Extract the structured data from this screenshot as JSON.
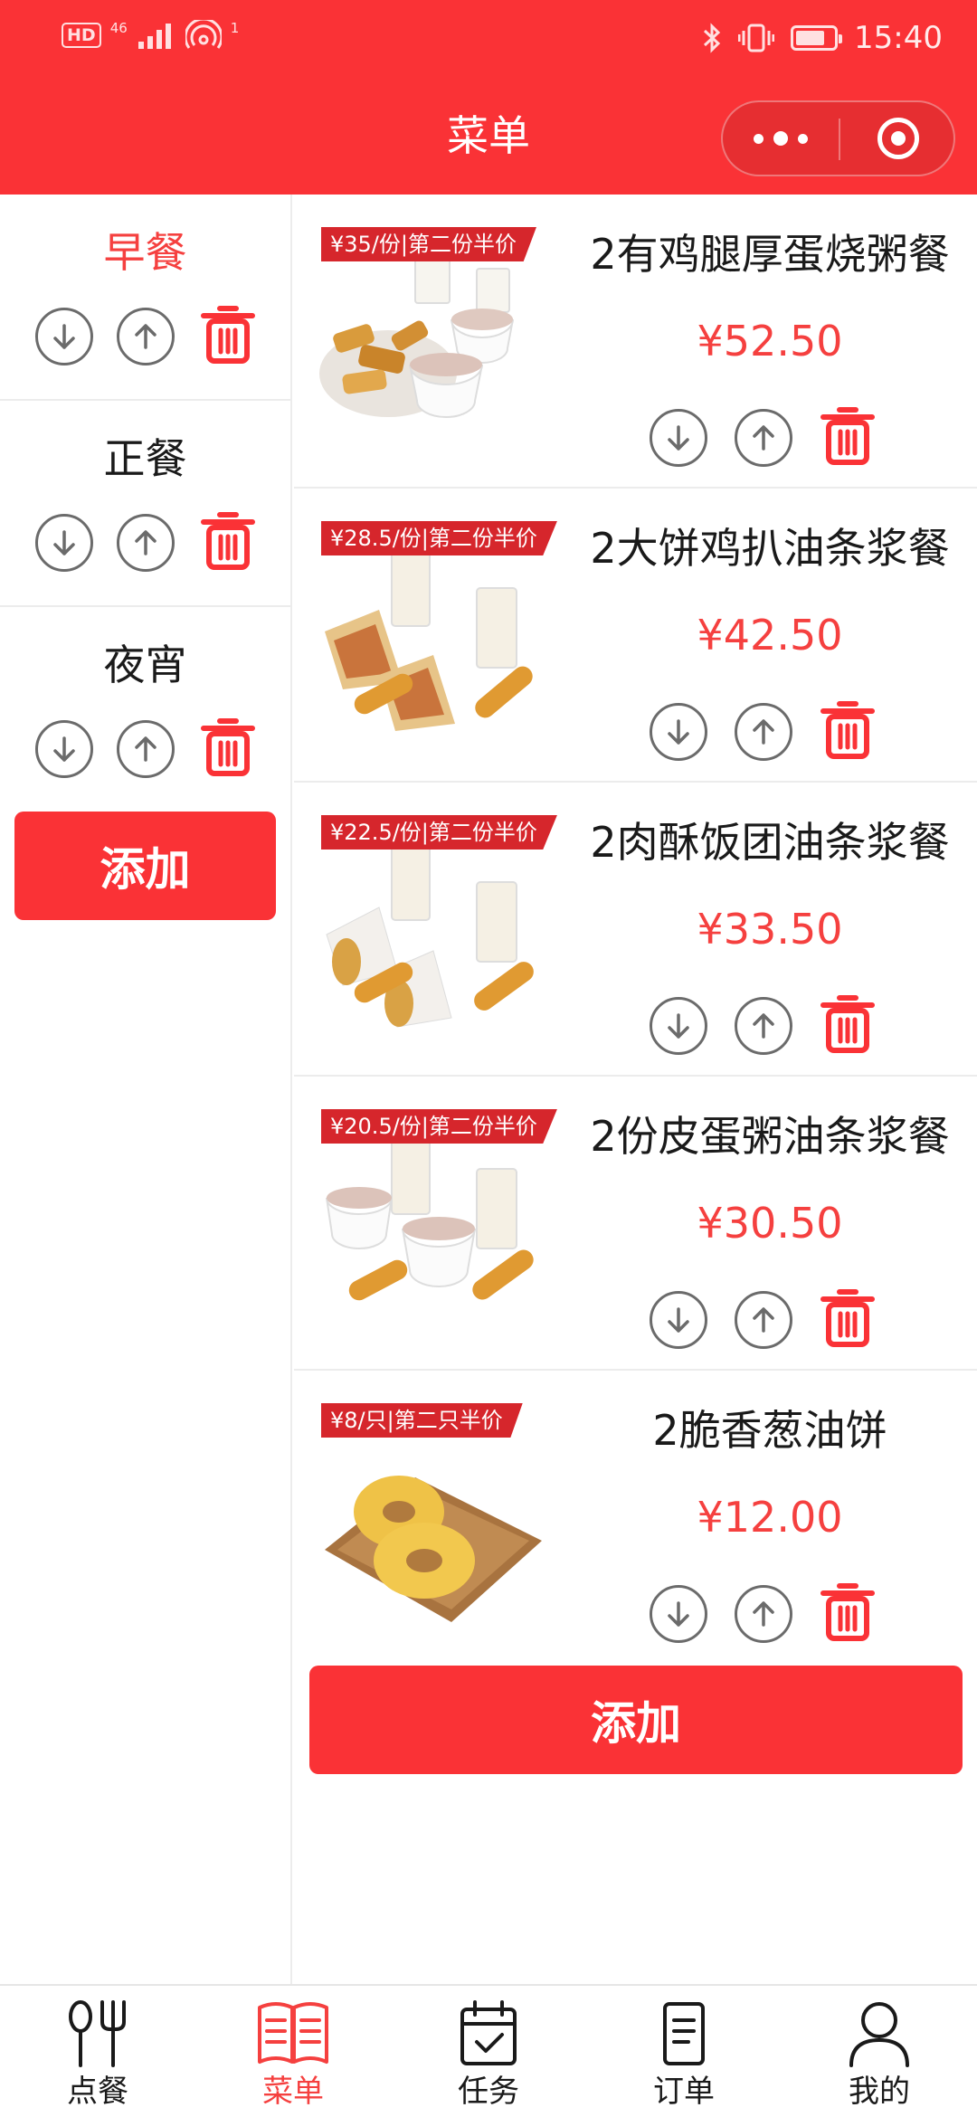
{
  "status_bar": {
    "hd": "HD",
    "net": "46",
    "signal_sup": "1",
    "time": "15:40",
    "battery_level": 0.78
  },
  "header": {
    "title": "菜单"
  },
  "colors": {
    "accent": "#fa3236",
    "price": "#f5403f"
  },
  "sidebar": {
    "categories": [
      {
        "name": "早餐",
        "active": true
      },
      {
        "name": "正餐",
        "active": false
      },
      {
        "name": "夜宵",
        "active": false
      }
    ],
    "add_label": "添加"
  },
  "menu": {
    "items": [
      {
        "promo": "¥35/份|第二份半价",
        "name": "2有鸡腿厚蛋烧粥餐",
        "price": "¥52.50"
      },
      {
        "promo": "¥28.5/份|第二份半价",
        "name": "2大饼鸡扒油条浆餐",
        "price": "¥42.50"
      },
      {
        "promo": "¥22.5/份|第二份半价",
        "name": "2肉酥饭团油条浆餐",
        "price": "¥33.50"
      },
      {
        "promo": "¥20.5/份|第二份半价",
        "name": "2份皮蛋粥油条浆餐",
        "price": "¥30.50"
      },
      {
        "promo": "¥8/只|第二只半价",
        "name": "2脆香葱油饼",
        "price": "¥12.00"
      }
    ],
    "add_label": "添加"
  },
  "tabbar": {
    "tabs": [
      {
        "label": "点餐",
        "icon": "utensils-icon"
      },
      {
        "label": "菜单",
        "icon": "book-icon",
        "active": true
      },
      {
        "label": "任务",
        "icon": "calendar-check-icon"
      },
      {
        "label": "订单",
        "icon": "document-icon"
      },
      {
        "label": "我的",
        "icon": "person-icon"
      }
    ]
  }
}
